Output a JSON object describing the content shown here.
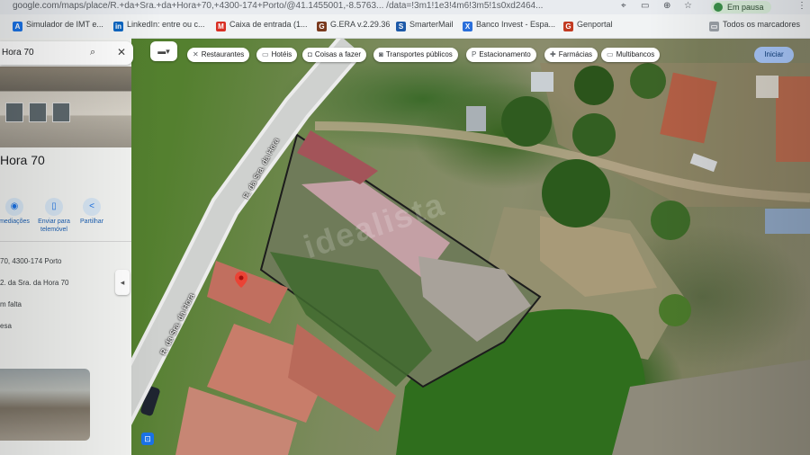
{
  "browser": {
    "url": "google.com/maps/place/R.+da+Sra.+da+Hora+70,+4300-174+Porto/@41.1455001,-8.5763... /data=!3m1!1e3!4m6!3m5!1s0xd2464...",
    "profile_label": "Em pausa",
    "bookmarks": [
      {
        "label": "Simulador de IMT e...",
        "icon": "A",
        "color": "#1a73e8"
      },
      {
        "label": "LinkedIn: entre ou c...",
        "icon": "in",
        "color": "#0a66c2"
      },
      {
        "label": "Caixa de entrada (1...",
        "icon": "M",
        "color": "#d93025"
      },
      {
        "label": "G.ERA v.2.29.36",
        "icon": "G",
        "color": "#7a3a1e"
      },
      {
        "label": "SmarterMail",
        "icon": "S",
        "color": "#1e5aa8"
      },
      {
        "label": "Banco Invest - Espa...",
        "icon": "X",
        "color": "#2a6fdb"
      },
      {
        "label": "Genportal",
        "icon": "G",
        "color": "#c23b22"
      }
    ],
    "all_bookmarks_label": "Todos os marcadores"
  },
  "maps": {
    "search_value": "Hora 70",
    "place_title": "Hora 70",
    "quick_actions": [
      {
        "label": "mediações",
        "icon": "pin-icon"
      },
      {
        "label": "Enviar para telemóvel",
        "icon": "phone-icon"
      },
      {
        "label": "Partilhar",
        "icon": "share-icon"
      }
    ],
    "info_lines": [
      "70, 4300-174 Porto",
      "2. da Sra. da Hora 70",
      "m falta",
      "esa"
    ],
    "chips": [
      {
        "label": "Restaurantes",
        "icon": "fork-icon"
      },
      {
        "label": "Hotéis",
        "icon": "bed-icon"
      },
      {
        "label": "Coisas a fazer",
        "icon": "camera-icon"
      },
      {
        "label": "Transportes públicos",
        "icon": "train-icon"
      },
      {
        "label": "Estacionamento",
        "icon": "parking-icon"
      },
      {
        "label": "Farmácias",
        "icon": "pharmacy-icon"
      },
      {
        "label": "Multibancos",
        "icon": "atm-icon"
      }
    ],
    "enter_label": "Iniciar",
    "road_labels": [
      "R. da Sra. da Hora",
      "R. da Sra. da Hora"
    ],
    "watermark": "idealista"
  }
}
